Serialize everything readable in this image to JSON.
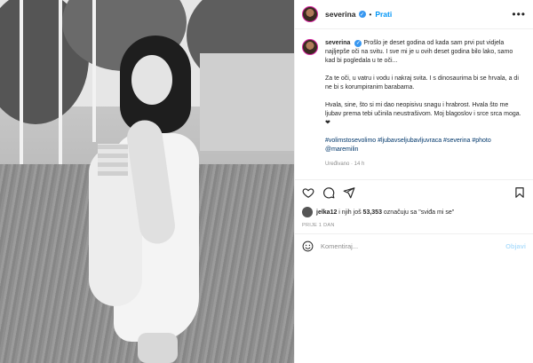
{
  "post": {
    "username": "severina",
    "follow_label": "Prati",
    "more_label": "•••",
    "verified_mark": "✓"
  },
  "caption": {
    "username": "severina",
    "p1": "Prošlo je deset godina od kada sam prvi put vidjela najljepše oči na svitu. I sve mi je u ovih deset godina bilo lako, samo kad bi pogledala u te oči...",
    "p2": "Za te oči, u vatru i vodu i nakraj svita. I s dinosaurima bi se hrvala, a di ne bi s korumpiranim barabama.",
    "p3": "Hvala, sine, što si mi dao neopisivu snagu i hrabrost. Hvala što me ljubav prema tebi učinila neustrašivom. Moj blagoslov i srce srca moga. ❤",
    "tags": "#volimstosevolimo #ljubavseljubavljuvraca #severina #photo @maremilin",
    "edited": "Uređivano · 14 h"
  },
  "actions": {
    "like_icon": "heart-icon",
    "comment_icon": "comment-icon",
    "share_icon": "paper-plane-icon",
    "save_icon": "bookmark-icon"
  },
  "likes": {
    "user": "jelka12",
    "middle": " i njih još ",
    "count": "53,353",
    "suffix": " označuju sa \"sviđa mi se\""
  },
  "date": "PRIJE 1 DAN",
  "comment": {
    "placeholder": "Komentiraj...",
    "post_label": "Objavi"
  }
}
